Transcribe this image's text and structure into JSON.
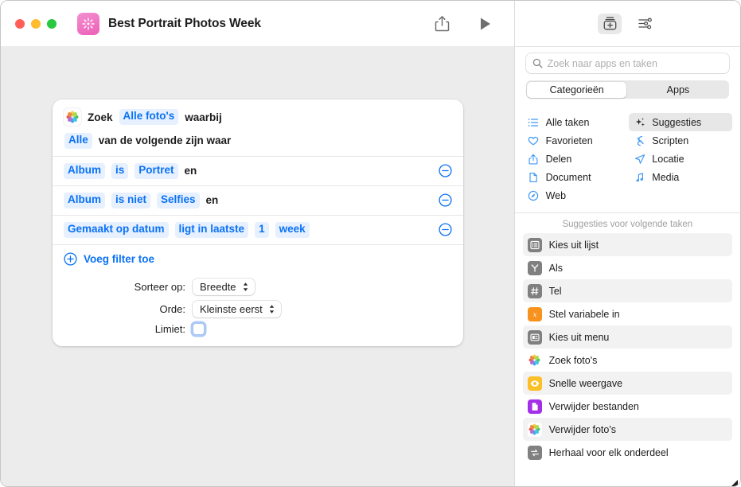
{
  "window": {
    "title": "Best Portrait Photos Week",
    "app_icon": "shortcuts-sparkle-icon",
    "share_icon": "share-icon",
    "play_icon": "play-icon"
  },
  "filter_card": {
    "source_icon": "photos-app-icon",
    "line1": {
      "prefix": "Zoek",
      "source": "Alle foto's",
      "suffix": "waarbij"
    },
    "line2": {
      "quantifier": "Alle",
      "text": "van de volgende zijn waar"
    },
    "rows": [
      {
        "field": "Album",
        "operator": "is",
        "value": "Portret",
        "conjunction": "en",
        "remove_icon": "minus-circle-icon"
      },
      {
        "field": "Album",
        "operator": "is niet",
        "value": "Selfies",
        "conjunction": "en",
        "remove_icon": "minus-circle-icon"
      },
      {
        "field": "Gemaakt op datum",
        "operator": "ligt in laatste",
        "value": "1",
        "unit": "week",
        "conjunction": "",
        "remove_icon": "minus-circle-icon"
      }
    ],
    "add_filter": {
      "icon": "plus-circle-icon",
      "label": "Voeg filter toe"
    },
    "options": [
      {
        "label": "Sorteer op:",
        "value": "Breedte",
        "control": "popup"
      },
      {
        "label": "Orde:",
        "value": "Kleinste eerst",
        "control": "popup"
      },
      {
        "label": "Limiet:",
        "value": "",
        "control": "checkbox",
        "checked": false
      }
    ]
  },
  "sidebar": {
    "toolbar": [
      {
        "name": "action-library-icon",
        "selected": true
      },
      {
        "name": "sliders-icon",
        "selected": false
      }
    ],
    "search": {
      "icon": "search-icon",
      "placeholder": "Zoek naar apps en taken",
      "value": ""
    },
    "segmented": [
      {
        "label": "Categorieën",
        "selected": true
      },
      {
        "label": "Apps",
        "selected": false
      }
    ],
    "categories": [
      {
        "label": "Alle taken",
        "icon": "list-bullet-icon",
        "selected": false
      },
      {
        "label": "Suggesties",
        "icon": "sparkles-icon",
        "selected": true
      },
      {
        "label": "Favorieten",
        "icon": "heart-icon",
        "selected": false
      },
      {
        "label": "Scripten",
        "icon": "script-icon",
        "selected": false
      },
      {
        "label": "Delen",
        "icon": "share-icon",
        "selected": false
      },
      {
        "label": "Locatie",
        "icon": "paperplane-icon",
        "selected": false
      },
      {
        "label": "Document",
        "icon": "document-icon",
        "selected": false
      },
      {
        "label": "Media",
        "icon": "music-note-icon",
        "selected": false
      },
      {
        "label": "Web",
        "icon": "safari-compass-icon",
        "selected": false
      }
    ],
    "suggestions_header": "Suggesties voor volgende taken",
    "suggestions": [
      {
        "label": "Kies uit lijst",
        "icon": "choose-from-list-icon",
        "icon_style": "gray"
      },
      {
        "label": "Als",
        "icon": "if-branch-icon",
        "icon_style": "gray"
      },
      {
        "label": "Tel",
        "icon": "count-hash-icon",
        "icon_style": "gray"
      },
      {
        "label": "Stel variabele in",
        "icon": "set-variable-icon",
        "icon_style": "orange"
      },
      {
        "label": "Kies uit menu",
        "icon": "choose-from-menu-icon",
        "icon_style": "gray"
      },
      {
        "label": "Zoek foto's",
        "icon": "photos-app-icon",
        "icon_style": "white"
      },
      {
        "label": "Snelle weergave",
        "icon": "quick-look-eye-icon",
        "icon_style": "yellow"
      },
      {
        "label": "Verwijder bestanden",
        "icon": "delete-files-icon",
        "icon_style": "purple"
      },
      {
        "label": "Verwijder foto's",
        "icon": "photos-app-icon",
        "icon_style": "white"
      },
      {
        "label": "Herhaal voor elk onderdeel",
        "icon": "repeat-each-icon",
        "icon_style": "gray"
      }
    ]
  },
  "colors": {
    "accent_blue": "#0a72f5",
    "pill_bg": "#e6f0fe",
    "canvas": "#ececec",
    "zebra": "#f2f2f2"
  }
}
